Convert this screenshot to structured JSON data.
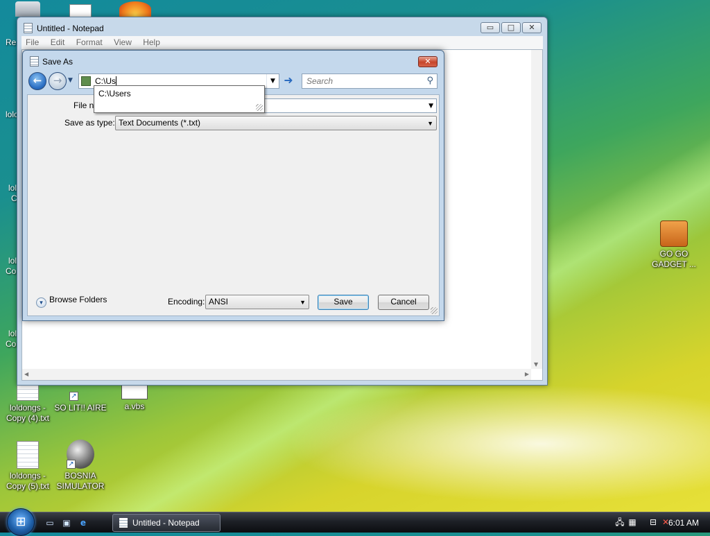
{
  "desktop": {
    "partial_labels": [
      "Re",
      "lolc",
      "lol",
      "C",
      "lol",
      "Co",
      "lol",
      "Co"
    ],
    "icons": [
      {
        "label": "loldongs - Copy (4).txt"
      },
      {
        "label": "SO LIT!! AIRE"
      },
      {
        "label": "a.vbs"
      },
      {
        "label": "loldongs - Copy (5).txt"
      },
      {
        "label": "BOSNIA SIMULATOR"
      },
      {
        "label": "GO GO GADGET ..."
      }
    ]
  },
  "notepad": {
    "title": "Untitled - Notepad",
    "menu": [
      "File",
      "Edit",
      "Format",
      "View",
      "Help"
    ],
    "caption_glyphs": {
      "minimize": "▭",
      "maximize": "□",
      "close": "✕"
    }
  },
  "save_dialog": {
    "title": "Save As",
    "close_glyph": "✕",
    "address_value": "C:\\Us",
    "search_placeholder": "Search",
    "autocomplete": [
      "C:\\Users"
    ],
    "file_name_label": "File na",
    "file_name_value": "",
    "save_as_type_label": "Save as type:",
    "save_as_type_value": "Text Documents (*.txt)",
    "browse_folders": "Browse Folders",
    "encoding_label": "Encoding:",
    "encoding_value": "ANSI",
    "save_button": "Save",
    "cancel_button": "Cancel"
  },
  "taskbar": {
    "task_label": "Untitled - Notepad",
    "clock": "6:01 AM"
  },
  "colors": {
    "accent": "#2b6fc4",
    "dialog_frame": "#c4d8ec",
    "close_red": "#c7452b"
  }
}
